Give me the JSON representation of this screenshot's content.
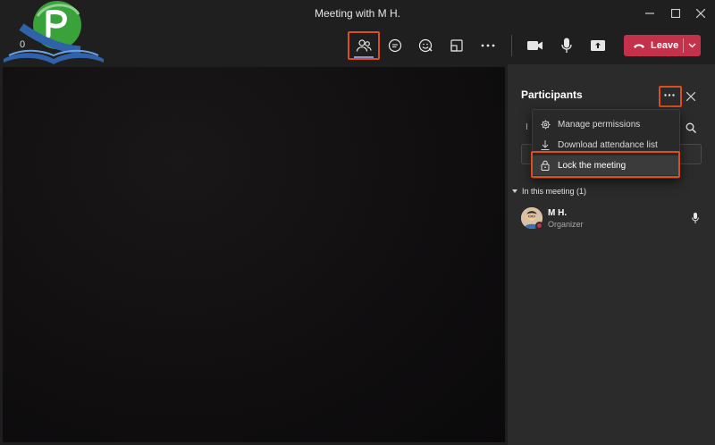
{
  "window": {
    "title": "Meeting with M H.",
    "partial_label": "0"
  },
  "toolbar": {
    "leave_label": "Leave",
    "buttons": [
      "people-icon",
      "chat-icon",
      "reactions-icon",
      "rooms-icon",
      "more-icon",
      "camera-icon",
      "mic-icon",
      "share-icon"
    ]
  },
  "panel": {
    "title": "Participants",
    "search_prefix": "I",
    "menu": {
      "items": [
        {
          "label": "Manage permissions",
          "icon": "gear-icon"
        },
        {
          "label": "Download attendance list",
          "icon": "download-icon"
        },
        {
          "label": "Lock the meeting",
          "icon": "lock-icon"
        }
      ]
    },
    "section_label": "In this meeting (1)",
    "participants": [
      {
        "name": "M H.",
        "role": "Organizer",
        "status": "busy"
      }
    ]
  },
  "colors": {
    "background": "#1f1f1f",
    "panel": "#2b2b2b",
    "leave": "#c4314b",
    "accent": "#8f90d8",
    "highlight": "#d9501e"
  }
}
